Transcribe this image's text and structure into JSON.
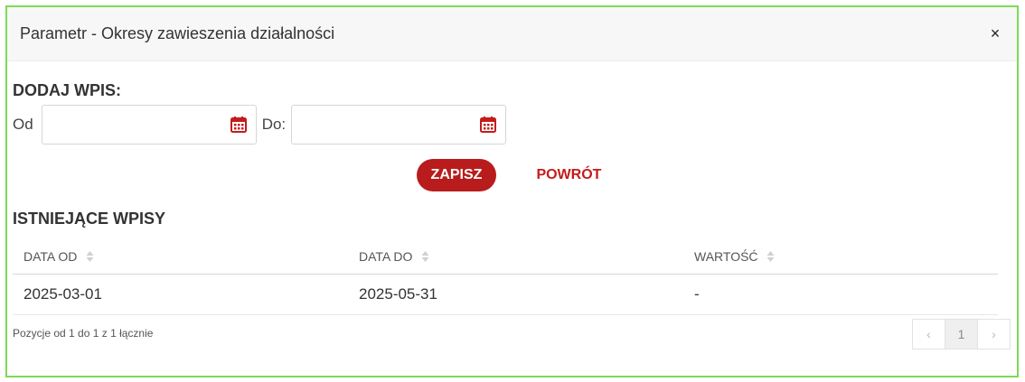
{
  "modal": {
    "title": "Parametr - Okresy zawieszenia działalności",
    "close_label": "×"
  },
  "add_section": {
    "title": "DODAJ WPIS:",
    "from_label": "Od",
    "to_label": "Do:",
    "from_value": "",
    "to_value": "",
    "calendar_icon": "calendar-icon",
    "save_label": "ZAPISZ",
    "back_label": "POWRÓT"
  },
  "existing_section": {
    "title": "ISTNIEJĄCE WPISY",
    "columns": [
      "DATA OD",
      "DATA DO",
      "WARTOŚĆ"
    ],
    "rows": [
      [
        "2025-03-01",
        "2025-05-31",
        "-"
      ]
    ]
  },
  "pagination": {
    "info": "Pozycje od 1 do 1 z 1 łącznie",
    "prev": "‹",
    "page": "1",
    "next": "›"
  },
  "colors": {
    "accent": "#b81c1c",
    "border_highlight": "#7ed957"
  }
}
